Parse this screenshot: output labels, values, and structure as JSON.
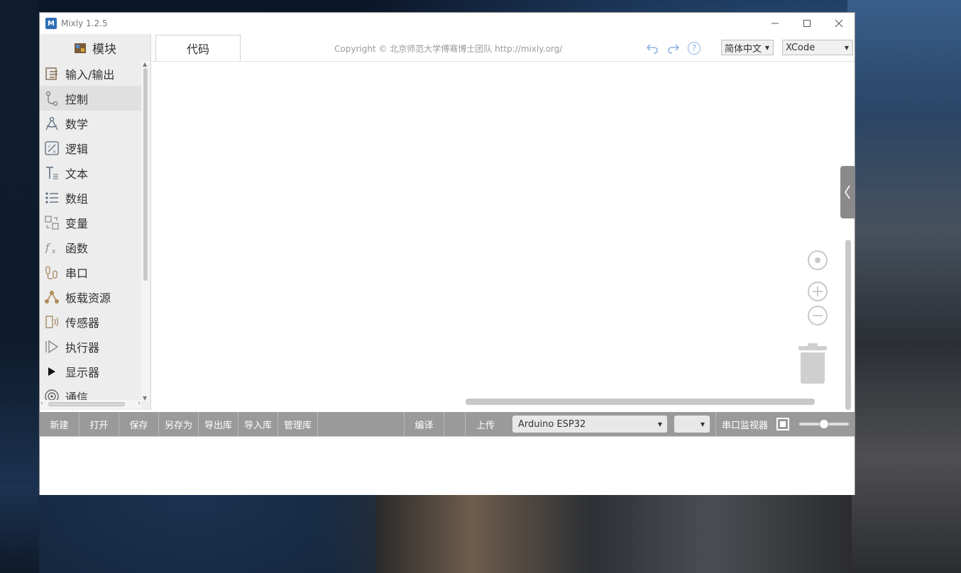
{
  "window": {
    "title": "Mixly 1.2.5",
    "logo_text": "M"
  },
  "sidebar": {
    "header": "模块",
    "categories": [
      {
        "label": "输入/输出",
        "icon": "io-icon"
      },
      {
        "label": "控制",
        "icon": "control-icon"
      },
      {
        "label": "数学",
        "icon": "math-icon"
      },
      {
        "label": "逻辑",
        "icon": "logic-icon"
      },
      {
        "label": "文本",
        "icon": "text-icon"
      },
      {
        "label": "数组",
        "icon": "list-icon"
      },
      {
        "label": "变量",
        "icon": "variable-icon"
      },
      {
        "label": "函数",
        "icon": "function-icon"
      },
      {
        "label": "串口",
        "icon": "serial-icon"
      },
      {
        "label": "板载资源",
        "icon": "board-resource-icon"
      },
      {
        "label": "传感器",
        "icon": "sensor-icon"
      },
      {
        "label": "执行器",
        "icon": "actuator-icon"
      },
      {
        "label": "显示器",
        "icon": "display-icon"
      },
      {
        "label": "通信",
        "icon": "communication-icon"
      }
    ]
  },
  "workspace": {
    "code_tab": "代码",
    "copyright": "Copyright © 北京师范大学傅骞博士团队 http://mixly.org/",
    "language": "简体中文",
    "theme": "XCode"
  },
  "toolbar": {
    "new": "新建",
    "open": "打开",
    "save": "保存",
    "save_as": "另存为",
    "export_lib": "导出库",
    "import_lib": "导入库",
    "manage_lib": "管理库",
    "compile": "编译",
    "upload": "上传",
    "board": "Arduino ESP32",
    "port": "",
    "serial_monitor": "串口监视器",
    "zoom_level": 0.5
  },
  "colors": {
    "toolbar_bg": "#9a9a9a",
    "accent_blue": "#8fb4e0",
    "sidebar_bg": "#ededed"
  }
}
